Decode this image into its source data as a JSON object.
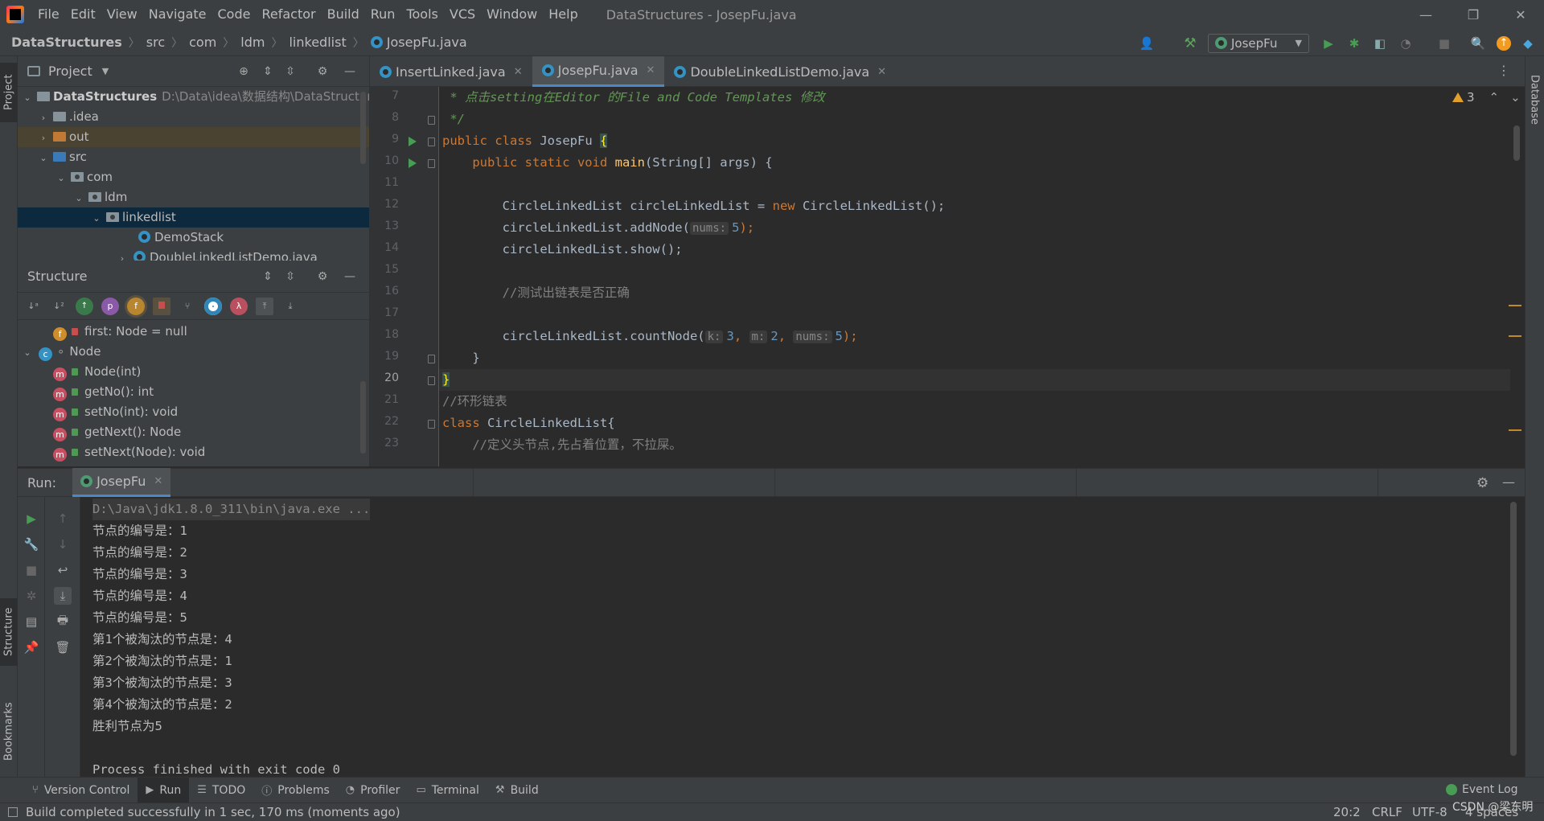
{
  "menu": [
    "File",
    "Edit",
    "View",
    "Navigate",
    "Code",
    "Refactor",
    "Build",
    "Run",
    "Tools",
    "VCS",
    "Window",
    "Help"
  ],
  "window_title": "DataStructures - JosepFu.java",
  "window_controls": {
    "minimize": "—",
    "restore": "❐",
    "close": "✕"
  },
  "breadcrumb": [
    "DataStructures",
    "src",
    "com",
    "ldm",
    "linkedlist",
    "JosepFu.java"
  ],
  "run_config": "JosepFu",
  "left_stripe": {
    "project": "Project",
    "structure": "Structure",
    "bookmarks": "Bookmarks"
  },
  "right_stripe": {
    "database": "Database"
  },
  "project_panel": {
    "title": "Project",
    "tree": [
      {
        "label": "DataStructures",
        "path": "D:\\Data\\idea\\数据结构\\DataStructures"
      },
      {
        "label": ".idea"
      },
      {
        "label": "out"
      },
      {
        "label": "src"
      },
      {
        "label": "com"
      },
      {
        "label": "ldm"
      },
      {
        "label": "linkedlist"
      },
      {
        "label": "DemoStack"
      },
      {
        "label": "DoubleLinkedListDemo.java"
      }
    ]
  },
  "structure_panel": {
    "title": "Structure",
    "toolbar_glyphs": {
      "p": "p",
      "f": "f",
      "lambda": "λ"
    },
    "items": [
      {
        "badge": "f",
        "label": "first: Node = null"
      },
      {
        "badge": "c",
        "label": "Node"
      },
      {
        "badge": "m",
        "label": "Node(int)"
      },
      {
        "badge": "m",
        "label": "getNo(): int"
      },
      {
        "badge": "m",
        "label": "setNo(int): void"
      },
      {
        "badge": "m",
        "label": "getNext(): Node"
      },
      {
        "badge": "m",
        "label": "setNext(Node): void"
      }
    ]
  },
  "editor": {
    "tabs": [
      "InsertLinked.java",
      "JosepFu.java",
      "DoubleLinkedListDemo.java"
    ],
    "active_tab": 1,
    "inspection_count": "3",
    "line_numbers": [
      "7",
      "8",
      "9",
      "10",
      "11",
      "12",
      "13",
      "14",
      "15",
      "16",
      "17",
      "18",
      "19",
      "20",
      "21",
      "22",
      "23"
    ],
    "code": {
      "l7": " * 点击setting在Editor 的File and Code Templates 修改",
      "l8": " */",
      "l9_kw": "public class ",
      "l9_name": "JosepFu ",
      "l9_brace": "{",
      "l10_kw": "    public static void ",
      "l10_fn": "main",
      "l10_rest": "(String[] args) {",
      "l12_a": "        CircleLinkedList circleLinkedList = ",
      "l12_kw": "new ",
      "l12_b": "CircleLinkedList();",
      "l13_a": "        circleLinkedList.addNode(",
      "l13_hint": "nums:",
      "l13_num": "5",
      "l13_end": ");",
      "l14": "        circleLinkedList.show();",
      "l16": "        //测试出链表是否正确",
      "l18_a": "        circleLinkedList.countNode(",
      "l18_h1": "k:",
      "l18_n1": "3",
      "l18_h2": "m:",
      "l18_n2": "2",
      "l18_h3": "nums:",
      "l18_n3": "5",
      "l18_end": ");",
      "l19": "    }",
      "l20": "}",
      "l21": "//环形链表",
      "l22_kw": "class ",
      "l22_rest": "CircleLinkedList{",
      "l23": "    //定义头节点,先占着位置，不拉屎。"
    }
  },
  "run_panel": {
    "label": "Run:",
    "tab": "JosepFu",
    "console": [
      "D:\\Java\\jdk1.8.0_311\\bin\\java.exe ...",
      "节点的编号是：1",
      "节点的编号是：2",
      "节点的编号是：3",
      "节点的编号是：4",
      "节点的编号是：5",
      "第1个被淘汰的节点是：4",
      "第2个被淘汰的节点是：1",
      "第3个被淘汰的节点是：3",
      "第4个被淘汰的节点是：2",
      "胜利节点为5",
      "",
      "Process finished with exit code 0"
    ]
  },
  "bottom_tools": [
    "Version Control",
    "Run",
    "TODO",
    "Problems",
    "Profiler",
    "Terminal",
    "Build"
  ],
  "event_log": "Event Log",
  "status": {
    "message": "Build completed successfully in 1 sec, 170 ms (moments ago)",
    "position": "20:2",
    "line_sep": "CRLF",
    "encoding": "UTF-8",
    "indent": "4 spaces",
    "watermark": "CSDN @梁东明"
  },
  "colors": {
    "accent": "#4a88c7",
    "run_green": "#499c54",
    "keyword": "#cc7832",
    "function": "#ffc66d",
    "doc_comment": "#629755",
    "number": "#6897bb"
  }
}
